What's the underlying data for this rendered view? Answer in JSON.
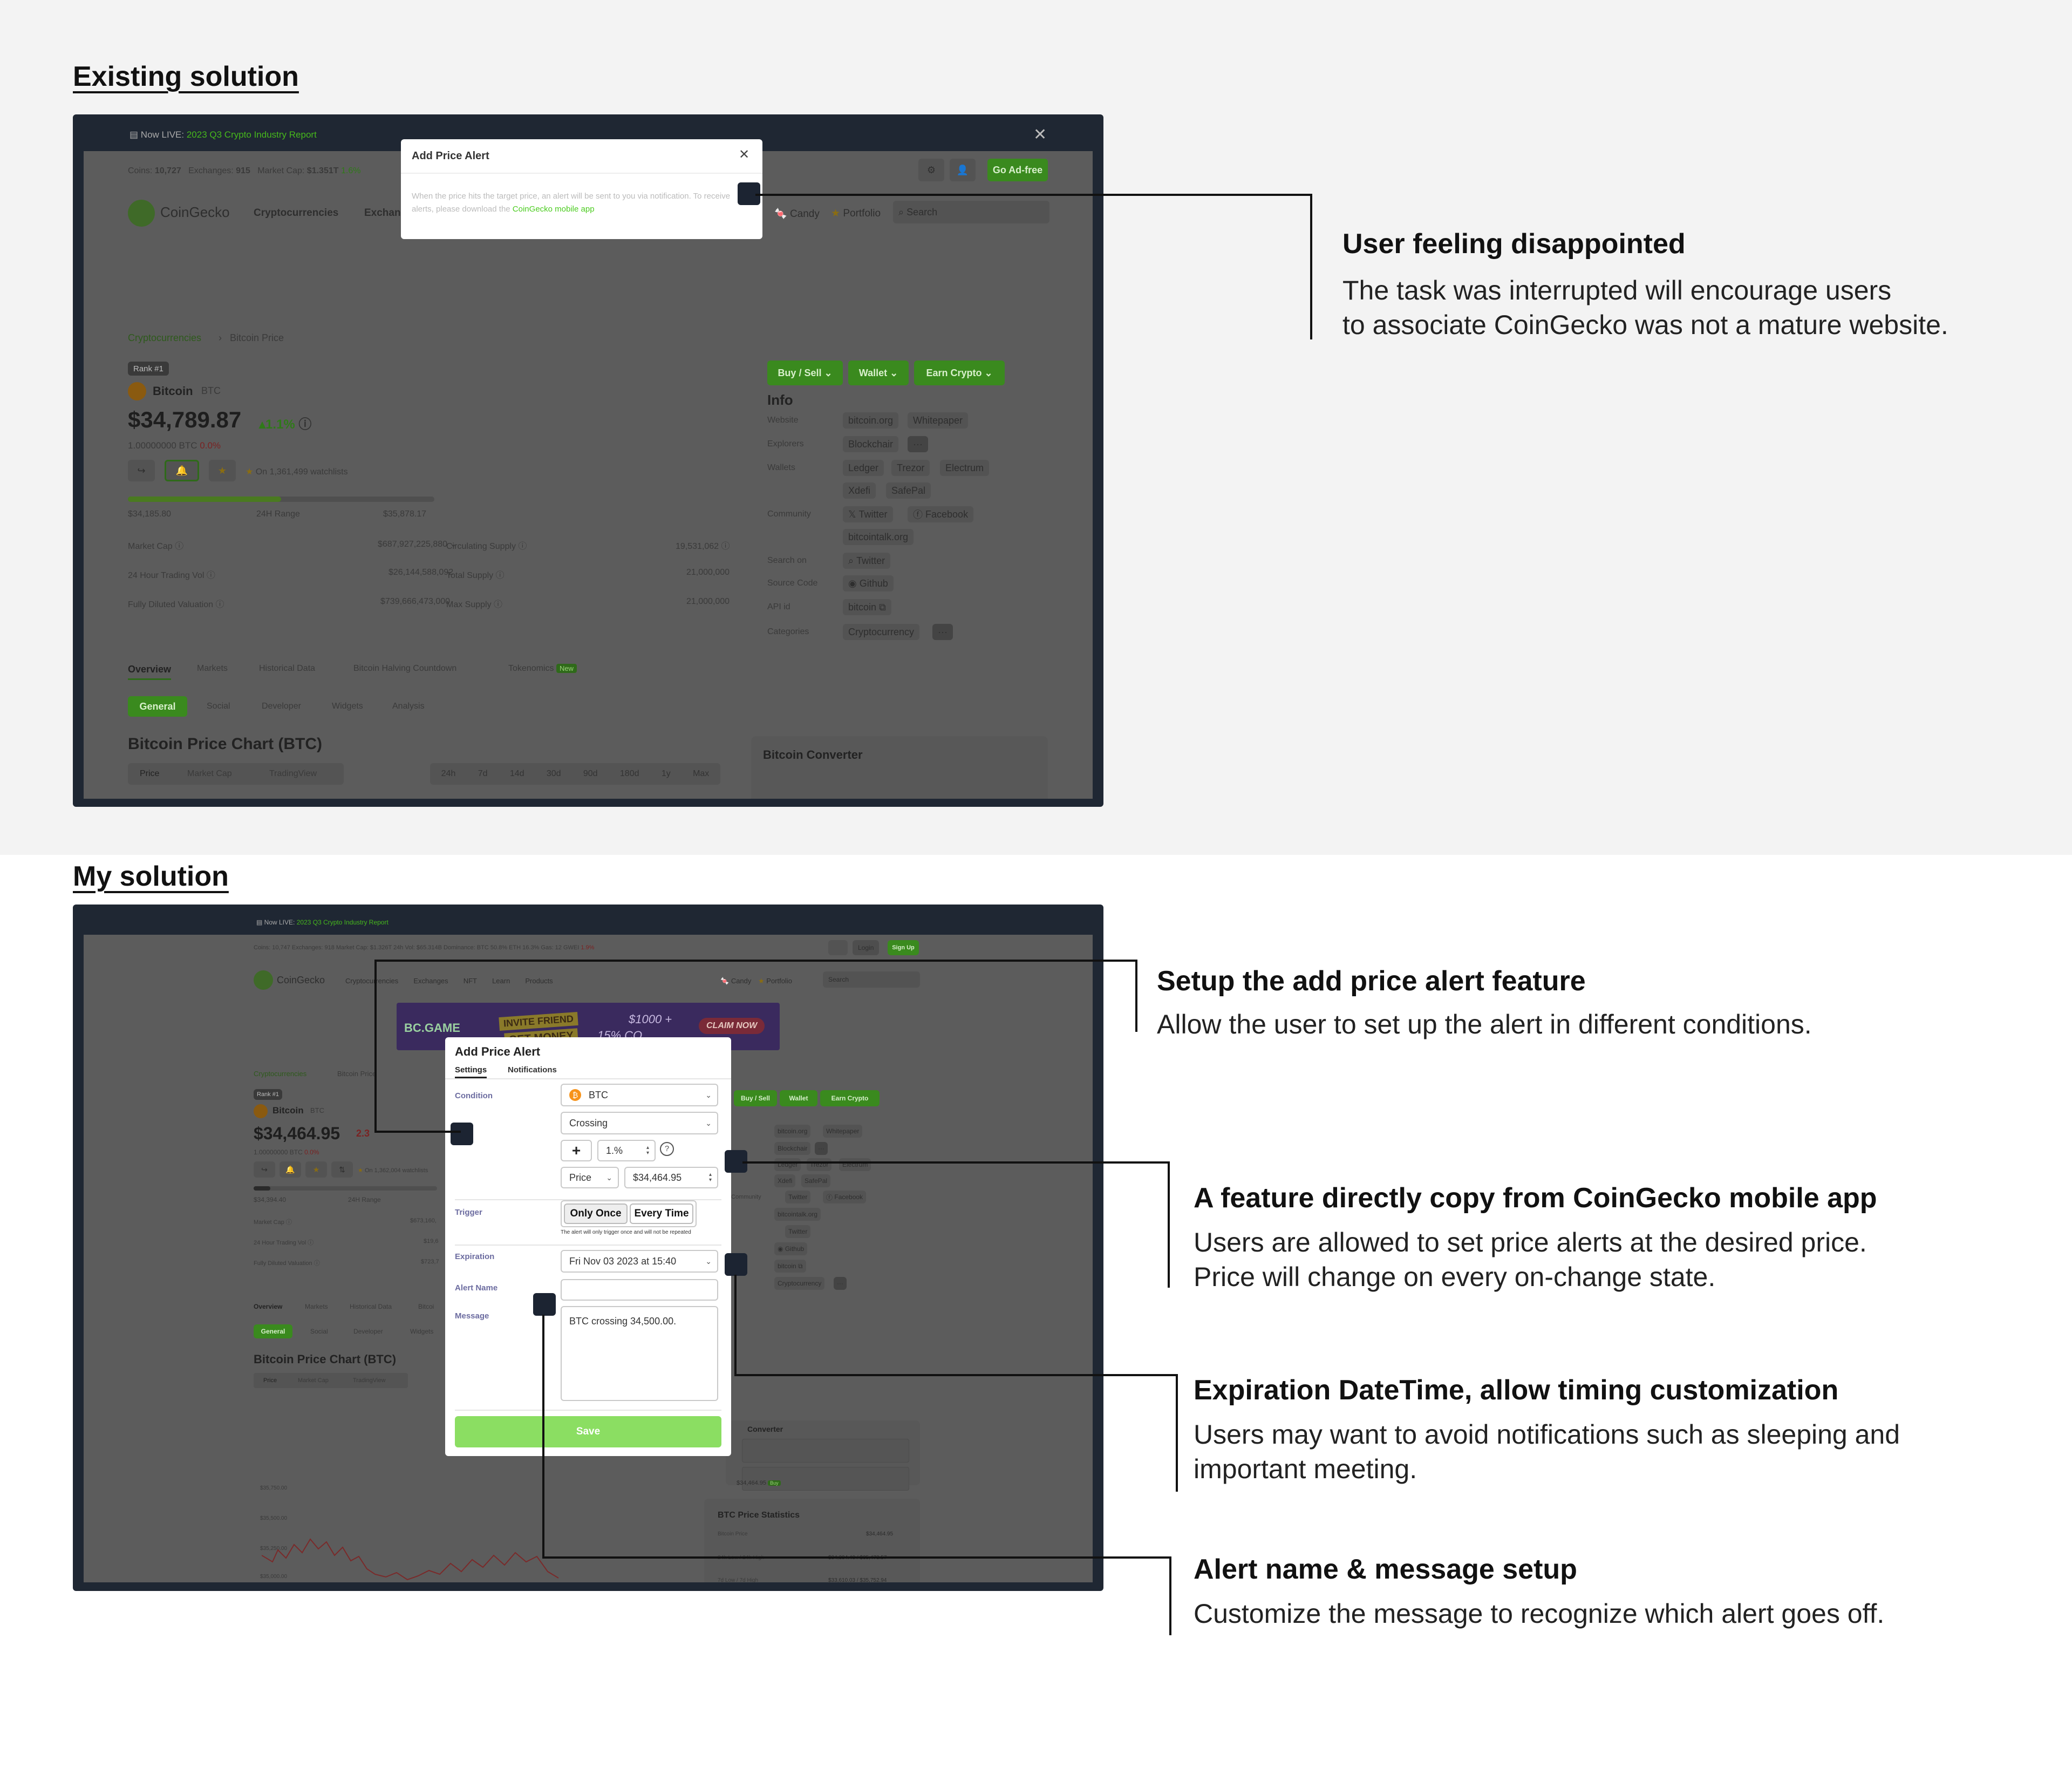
{
  "sections": {
    "existing_title": "Existing solution",
    "mine_title": "My solution"
  },
  "existing": {
    "banner": "Now LIVE:",
    "banner_link": "2023 Q3 Crypto Industry Report",
    "stats": {
      "coins_label": "Coins:",
      "coins": "10,727",
      "exchanges_label": "Exchanges:",
      "exchanges": "915",
      "mcap_label": "Market Cap:",
      "mcap": "$1.351T",
      "mcap_change": "1.6%"
    },
    "go_adfree": "Go Ad-free",
    "logo": "CoinGecko",
    "nav": [
      "Cryptocurrencies",
      "Exchan"
    ],
    "candy": "Candy",
    "portfolio": "Portfolio",
    "search_placeholder": "Search",
    "breadcrumb": [
      "Cryptocurrencies",
      "Bitcoin Price"
    ],
    "rank": "Rank #1",
    "coin_name": "Bitcoin",
    "coin_symbol": "BTC",
    "price": "$34,789.87",
    "change": "1.1%",
    "btc_line": "1.00000000 BTC",
    "btc_change": "0.0%",
    "watchlists": "On 1,361,499 watchlists",
    "range_low": "$34,185.80",
    "range_label": "24H Range",
    "range_high": "$35,878.17",
    "metrics": [
      {
        "label": "Market Cap",
        "value": "$687,927,225,880"
      },
      {
        "label": "24 Hour Trading Vol",
        "value": "$26,144,588,092"
      },
      {
        "label": "Fully Diluted Valuation",
        "value": "$739,666,473,000"
      }
    ],
    "supply": [
      {
        "label": "Circulating Supply",
        "value": "19,531,062"
      },
      {
        "label": "Total Supply",
        "value": "21,000,000"
      },
      {
        "label": "Max Supply",
        "value": "21,000,000"
      }
    ],
    "action_buttons": [
      "Buy / Sell",
      "Wallet",
      "Earn Crypto"
    ],
    "info_title": "Info",
    "info_rows": [
      {
        "label": "Website",
        "values": [
          "bitcoin.org",
          "Whitepaper"
        ]
      },
      {
        "label": "Explorers",
        "values": [
          "Blockchair",
          "···"
        ]
      },
      {
        "label": "Wallets",
        "values": [
          "Ledger",
          "Trezor",
          "Electrum",
          "Xdefi",
          "SafePal"
        ]
      },
      {
        "label": "Community",
        "values": [
          "Twitter",
          "Facebook",
          "bitcointalk.org"
        ]
      },
      {
        "label": "Search on",
        "values": [
          "Twitter"
        ]
      },
      {
        "label": "Source Code",
        "values": [
          "Github"
        ]
      },
      {
        "label": "API id",
        "values": [
          "bitcoin"
        ]
      },
      {
        "label": "Categories",
        "values": [
          "Cryptocurrency",
          "···"
        ]
      }
    ],
    "tabs": [
      "Overview",
      "Markets",
      "Historical Data",
      "Bitcoin Halving Countdown",
      "Tokenomics"
    ],
    "new_badge": "New",
    "subtabs": [
      "General",
      "Social",
      "Developer",
      "Widgets",
      "Analysis"
    ],
    "chart_title": "Bitcoin Price Chart (BTC)",
    "chart_tabs": [
      "Price",
      "Market Cap",
      "TradingView"
    ],
    "ranges": [
      "24h",
      "7d",
      "14d",
      "30d",
      "90d",
      "180d",
      "1y",
      "Max"
    ],
    "converter": "Bitcoin Converter",
    "modal_title": "Add Price Alert",
    "modal_body": "When the price hits the target price, an alert will be sent to you via notification. To receive alerts, please download the",
    "modal_link": "CoinGecko mobile app"
  },
  "mine": {
    "banner": "Now LIVE:",
    "banner_link": "2023 Q3 Crypto Industry Report",
    "stats": "Coins: 10,747   Exchanges: 918   Market Cap: $1.326T   24h Vol: $65.314B   Dominance: BTC 50.8% ETH 16.3%   Gas: 12 GWEI",
    "mcap_change": "1.9%",
    "login": "Login",
    "signup": "Sign Up",
    "logo": "CoinGecko",
    "nav": [
      "Cryptocurrencies",
      "Exchanges",
      "NFT",
      "Learn",
      "Products"
    ],
    "candy": "Candy",
    "portfolio": "Portfolio",
    "search_placeholder": "Search",
    "ad_brand": "BC.GAME",
    "ad_invite": "INVITE FRIEND",
    "ad_money": "GET MONEY",
    "ad_amount": "$1000 +",
    "ad_pct": "15% CO",
    "ad_claim": "CLAIM NOW",
    "breadcrumb": [
      "Cryptocurrencies",
      "Bitcoin Price"
    ],
    "rank": "Rank #1",
    "coin_name": "Bitcoin",
    "coin_symbol": "BTC",
    "price": "$34,464.95",
    "change": "2.3",
    "btc_line": "1.00000000 BTC",
    "btc_change": "0.0%",
    "watchlists": "On 1,362,004 watchlists",
    "range_low": "$34,394.40",
    "range_label": "24H Range",
    "metrics": [
      {
        "label": "Market Cap",
        "value": "$673,160,"
      },
      {
        "label": "24 Hour Trading Vol",
        "value": "$19,6"
      },
      {
        "label": "Fully Diluted Valuation",
        "value": "$723,7"
      }
    ],
    "action_buttons": [
      "Buy / Sell",
      "Wallet",
      "Earn Crypto"
    ],
    "info_rows": [
      {
        "label": "Website",
        "values": [
          "bitcoin.org",
          "Whitepaper"
        ]
      },
      {
        "label": "Explorers",
        "values": [
          "Blockchair",
          "···"
        ]
      },
      {
        "label": "Wallets",
        "values": [
          "Ledger",
          "Trezor",
          "Electrum",
          "Xdefi",
          "SafePal"
        ]
      },
      {
        "label": "Community",
        "values": [
          "Twitter",
          "Facebook",
          "bitcointalk.org"
        ]
      },
      {
        "label": "Search on",
        "values": [
          "Twitter"
        ]
      },
      {
        "label": "Source Code",
        "values": [
          "Github"
        ]
      },
      {
        "label": "API id",
        "values": [
          "bitcoin"
        ]
      },
      {
        "label": "Categories",
        "values": [
          "Cryptocurrency",
          "···"
        ]
      }
    ],
    "tabs": [
      "Overview",
      "Markets",
      "Historical Data",
      "Bitcoi"
    ],
    "subtabs": [
      "General",
      "Social",
      "Developer",
      "Widgets"
    ],
    "chart_title": "Bitcoin Price Chart (BTC)",
    "chart_tabs": [
      "Price",
      "Market Cap",
      "TradingView"
    ],
    "y_ticks": [
      "$35,750.00",
      "$35,500.00",
      "$35,250.00",
      "$35,000.00",
      "$34,750.00"
    ],
    "converter": "Converter",
    "converter_value": "$34,464.95",
    "converter_badge": "Buy",
    "stats_title": "BTC Price Statistics",
    "stats_rows": [
      {
        "label": "Bitcoin Price",
        "value": "$34,464.95"
      },
      {
        "label": "24h Low / 24h High",
        "value": "$34,394.40 / $35,473.57"
      },
      {
        "label": "7d Low / 7d High",
        "value": "$33,610.03 / $35,752.94"
      }
    ],
    "modal": {
      "title": "Add Price Alert",
      "tabs": [
        "Settings",
        "Notifications"
      ],
      "condition_label": "Condition",
      "coin_value": "BTC",
      "crossing_value": "Crossing",
      "plus": "+",
      "pct_value": "1.%",
      "help": "?",
      "price_select": "Price",
      "price_value": "$34,464.95",
      "trigger_label": "Trigger",
      "trigger_options": [
        "Only Once",
        "Every Time"
      ],
      "trigger_note": "The alert will only trigger once and will not be repeated",
      "expiration_label": "Expiration",
      "expiration_value": "Fri Nov 03 2023 at 15:40",
      "alert_name_label": "Alert Name",
      "message_label": "Message",
      "message_value": "BTC crossing 34,500.00.",
      "save": "Save"
    }
  },
  "annotations": [
    {
      "title": "User feeling disappointed",
      "body": [
        "The task was interrupted will encourage users",
        "to associate CoinGecko was not a mature website."
      ]
    },
    {
      "title": "Setup the add price alert feature",
      "body": [
        "Allow the user to set up the alert in different conditions."
      ]
    },
    {
      "title": "A feature directly copy from CoinGecko mobile app",
      "body": [
        "Users are allowed to set price alerts at the desired price.",
        "Price will change on every on-change state."
      ]
    },
    {
      "title": "Expiration DateTime, allow timing customization",
      "body": [
        "Users may want to avoid notifications such as sleeping and",
        "important meeting."
      ]
    },
    {
      "title": "Alert name & message setup",
      "body": [
        "Customize the message to recognize which alert goes off."
      ]
    }
  ],
  "colors": {
    "accent_green": "#4bcc1f",
    "overlay": "#5c5c5c",
    "frame": "#1f2733",
    "red": "#e0393e"
  }
}
